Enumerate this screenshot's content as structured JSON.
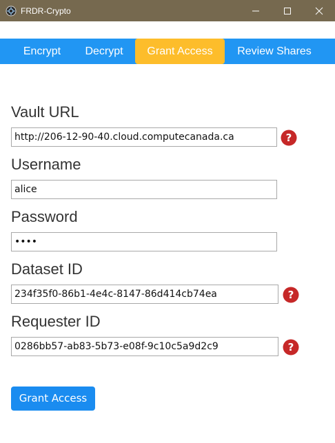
{
  "window": {
    "title": "FRDR-Crypto",
    "icon": "app-logo-icon",
    "controls": [
      "minimize-icon",
      "maximize-icon",
      "close-icon"
    ]
  },
  "tabs": [
    {
      "label": "Encrypt",
      "active": false
    },
    {
      "label": "Decrypt",
      "active": false
    },
    {
      "label": "Grant Access",
      "active": true
    },
    {
      "label": "Review Shares",
      "active": false
    }
  ],
  "form": {
    "vault_url": {
      "label": "Vault URL",
      "value": "http://206-12-90-40.cloud.computecanada.ca",
      "help": true
    },
    "username": {
      "label": "Username",
      "value": "alice"
    },
    "password": {
      "label": "Password",
      "value": "••••"
    },
    "dataset_id": {
      "label": "Dataset ID",
      "value": "234f35f0-86b1-4e4c-8147-86d414cb74ea",
      "help": true
    },
    "requester_id": {
      "label": "Requester ID",
      "value": "0286bb57-ab83-5b73-e08f-9c10c5a9d2c9",
      "help": true
    }
  },
  "submit_label": "Grant Access",
  "colors": {
    "titlebar": "#76694f",
    "tabbar": "#2196f3",
    "active_tab": "#fdbd2b",
    "button": "#1a8cf0",
    "help_icon": "#c62828"
  }
}
